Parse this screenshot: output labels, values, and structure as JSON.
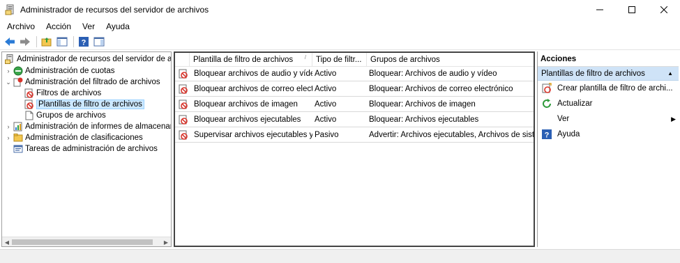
{
  "window": {
    "title": "Administrador de recursos del servidor de archivos",
    "minimize": "minimize",
    "maximize": "maximize",
    "close": "close"
  },
  "menu": [
    "Archivo",
    "Acción",
    "Ver",
    "Ayuda"
  ],
  "toolbar": {
    "buttons": [
      "back-arrow-icon",
      "forward-arrow-icon",
      "up-folder-icon",
      "show-hide-tree-icon",
      "help-icon",
      "show-hide-action-pane-icon"
    ]
  },
  "tree": {
    "root": "Administrador de recursos del servidor de arch",
    "items": [
      {
        "label": "Administración de cuotas",
        "expander": "›"
      },
      {
        "label": "Administración del filtrado de archivos",
        "expander": "⌄"
      },
      {
        "label": "Filtros de archivos",
        "expander": ""
      },
      {
        "label": "Plantillas de filtro de archivos",
        "expander": ""
      },
      {
        "label": "Grupos de archivos",
        "expander": ""
      },
      {
        "label": "Administración de informes de almacenam",
        "expander": "›"
      },
      {
        "label": "Administración de clasificaciones",
        "expander": "›"
      },
      {
        "label": "Tareas de administración de archivos",
        "expander": ""
      }
    ]
  },
  "list": {
    "columns": [
      "Plantilla de filtro de archivos",
      "Tipo de filtr...",
      "Grupos de archivos"
    ],
    "rows": [
      {
        "name": "Bloquear archivos de audio y vídeo",
        "type": "Activo",
        "groups": "Bloquear: Archivos de audio y vídeo"
      },
      {
        "name": "Bloquear archivos de correo electr...",
        "type": "Activo",
        "groups": "Bloquear: Archivos de correo electrónico"
      },
      {
        "name": "Bloquear archivos de imagen",
        "type": "Activo",
        "groups": "Bloquear: Archivos de imagen"
      },
      {
        "name": "Bloquear archivos ejecutables",
        "type": "Activo",
        "groups": "Bloquear: Archivos ejecutables"
      },
      {
        "name": "Supervisar archivos ejecutables y ...",
        "type": "Pasivo",
        "groups": "Advertir: Archivos ejecutables, Archivos de sist..."
      }
    ]
  },
  "actions": {
    "title": "Acciones",
    "section": "Plantillas de filtro de archivos",
    "items": [
      {
        "label": "Crear plantilla de filtro de archi...",
        "icon": "create-template-icon"
      },
      {
        "label": "Actualizar",
        "icon": "refresh-icon"
      },
      {
        "label": "Ver",
        "icon": ""
      },
      {
        "label": "Ayuda",
        "icon": "help-icon"
      }
    ]
  },
  "colors": {
    "selection": "#cce8ff",
    "section_header": "#cfe3f7",
    "toolbar_blue": "#2b7bd6"
  }
}
